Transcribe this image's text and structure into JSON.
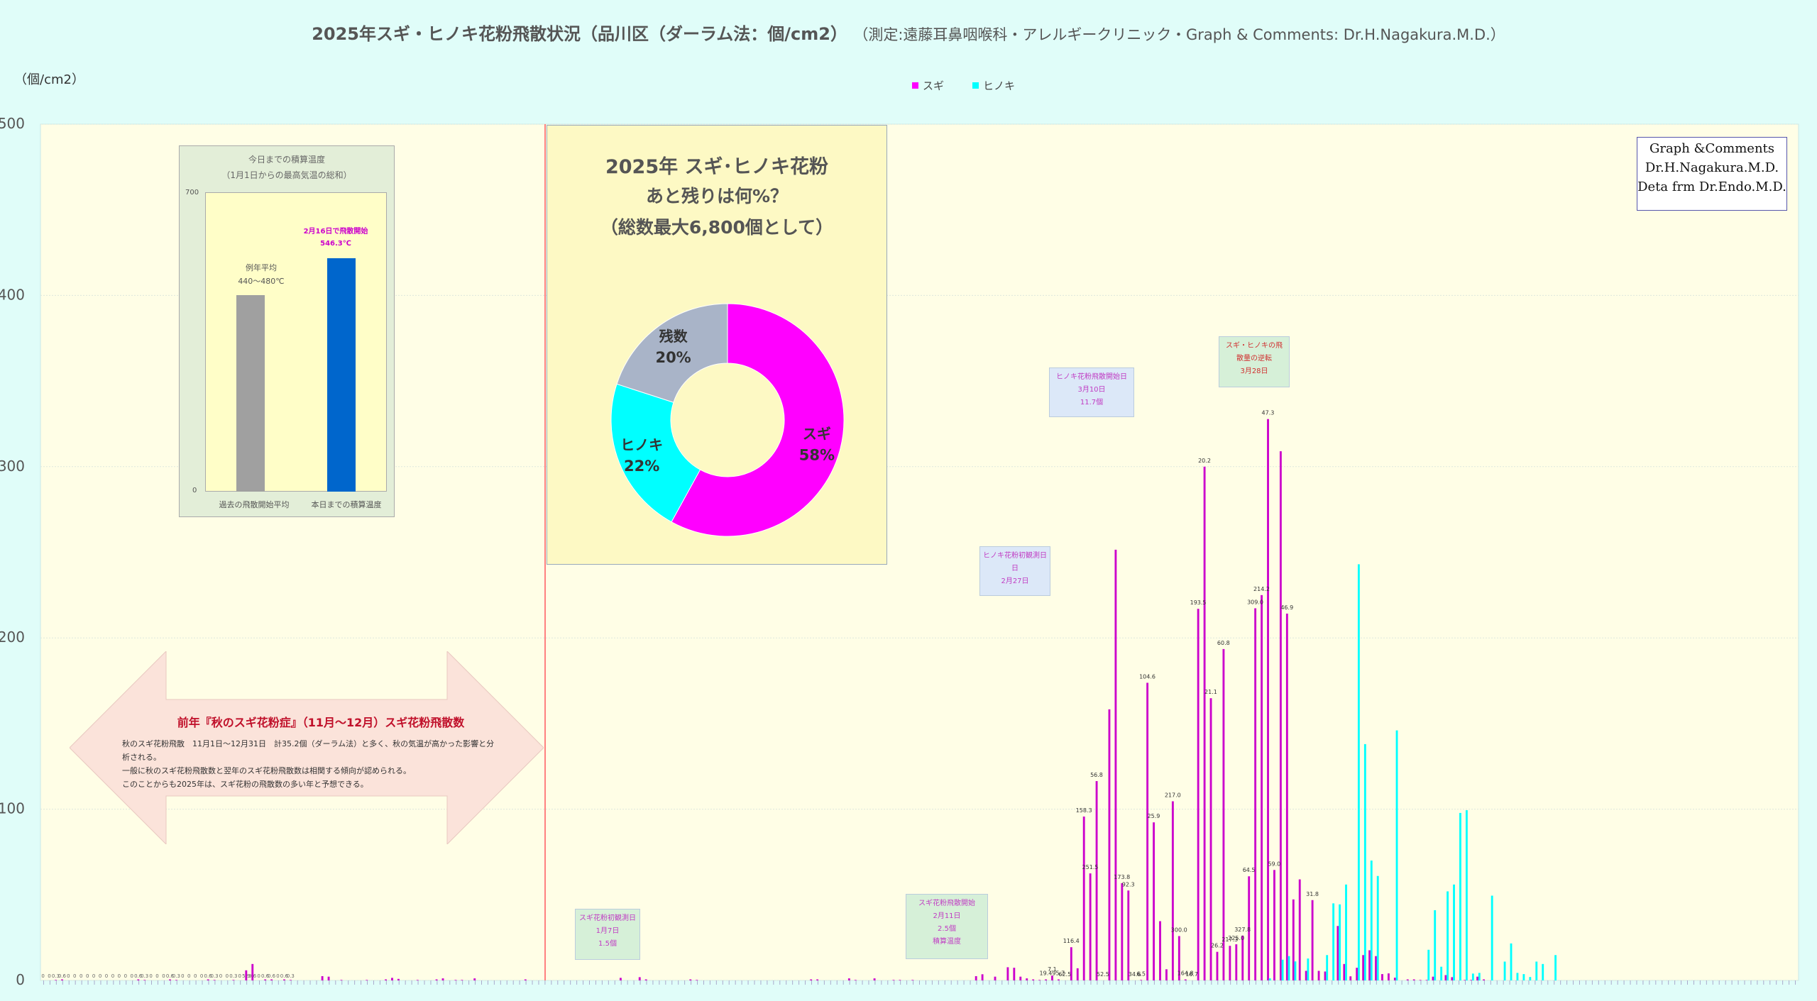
{
  "title": "2025年スギ・ヒノキ花粉飛散状況（品川区（ダーラム法：個/cm2）",
  "subtitle": "（測定:遠藤耳鼻咽喉科・アレルギークリニック・Graph & Comments: Dr.H.Nagakura.M.D.）",
  "unit": "（個/cm2）",
  "credit": [
    "Graph &Comments",
    "Dr.H.Nagakura.M.D.",
    "Deta frm Dr.Endo.M.D."
  ],
  "colors": {
    "sugi": "#ff00ff",
    "hinoki": "#00ffff",
    "plot_bg": "#fffee6",
    "page_bg": "#e0fdf9",
    "divider": "#ff8080",
    "bar_purple": "#cc00cc"
  },
  "chart_data": [
    {
      "type": "bar",
      "ylim": [
        0,
        500
      ],
      "yticks": [
        0,
        100,
        200,
        300,
        400,
        500
      ],
      "grid": true,
      "legend_position": "top",
      "series": [
        {
          "name": "スギ",
          "color": "#ff00ff",
          "values": [
            0,
            0,
            0.3,
            0.6,
            0,
            0,
            0,
            0,
            0,
            0,
            0,
            0,
            0,
            0,
            0,
            0.6,
            0.3,
            0,
            0,
            0,
            0.6,
            0.3,
            0,
            0,
            0,
            0,
            0.6,
            0.3,
            0,
            0,
            0.3,
            0,
            5.9,
            9.6,
            0,
            0.6,
            0.6,
            0,
            0.6,
            0.3,
            0,
            0,
            0,
            0,
            2.5,
            2.2,
            0,
            0.3,
            0,
            0,
            0,
            0.3,
            0,
            0,
            0.6,
            1.5,
            0.9,
            0,
            0,
            0.3,
            0,
            0,
            0.6,
            1.2,
            0,
            0.3,
            0.3,
            0,
            1.2,
            0,
            0,
            0,
            0,
            0,
            0,
            0,
            0.6,
            0,
            0,
            0,
            0,
            0,
            0,
            0,
            0,
            0,
            0,
            0,
            0,
            0,
            0,
            1.5,
            0,
            0,
            1.9,
            0.6,
            0,
            0,
            0,
            0,
            0,
            0,
            0.6,
            0.3,
            0,
            0,
            0,
            0,
            0,
            0,
            0,
            0,
            0,
            0,
            0,
            0,
            0,
            0,
            0,
            0,
            0,
            0.6,
            0.6,
            0,
            0,
            0,
            0,
            1.2,
            0.3,
            0,
            0,
            1.2,
            0,
            0,
            0.3,
            0.3,
            0,
            0.3,
            0,
            0,
            0,
            0,
            0,
            0,
            0,
            0,
            0,
            2.5,
            3.6,
            0,
            2.2,
            0,
            7.7,
            7.4,
            2.2,
            1.2,
            0.6,
            0.3,
            0.6,
            2.8,
            0.6,
            0,
            19.4,
            7.1,
            95.7,
            62.5,
            116.4,
            0,
            158.3,
            251.5,
            56.8,
            52.5,
            0,
            0.3,
            173.8,
            92.3,
            34.6,
            6.5,
            104.6,
            25.9,
            0.6,
            0,
            217.0,
            300.0,
            164.8,
            16.7,
            193.5,
            20.2,
            21.1,
            26.2,
            60.8,
            217.3,
            225.0,
            327.8,
            64.5,
            309.0,
            214.2,
            47.3,
            59.0,
            5.6,
            46.9,
            5.6,
            5.2,
            0,
            31.8,
            9.6,
            2.4,
            7.4,
            14.8,
            17.6,
            14.2,
            3.7,
            4.1,
            1.6,
            0,
            0.6,
            0.6,
            0.3,
            0.3,
            2.2,
            0,
            3.1,
            1.9,
            0,
            0.3,
            0.3,
            2.2,
            0.6,
            0,
            0,
            0,
            0,
            0,
            0,
            0,
            0,
            0,
            0,
            0,
            0,
            0,
            0,
            0,
            0,
            0,
            0,
            0,
            0,
            0,
            0,
            0,
            0,
            0,
            0,
            0,
            0,
            0,
            0,
            0,
            0,
            0,
            0,
            0,
            0,
            0,
            0,
            0,
            0,
            0,
            0,
            0,
            0,
            0,
            0,
            0,
            0,
            0
          ]
        },
        {
          "name": "ヒノキ",
          "color": "#00ffff",
          "values": [
            0,
            0,
            0,
            0,
            0,
            0,
            0,
            0,
            0,
            0,
            0,
            0,
            0,
            0,
            0,
            0,
            0,
            0,
            0,
            0,
            0,
            0,
            0,
            0,
            0,
            0,
            0,
            0,
            0,
            0,
            0,
            0,
            0,
            0,
            0,
            0,
            0,
            0,
            0,
            0,
            0,
            0,
            0,
            0,
            0,
            0,
            0,
            0,
            0,
            0,
            0,
            0,
            0,
            0,
            0,
            0,
            0,
            0,
            0,
            0,
            0,
            0,
            0,
            0,
            0,
            0,
            0,
            0,
            0,
            0,
            0,
            0,
            0,
            0,
            0,
            0,
            0,
            0,
            0,
            0,
            0,
            0,
            0,
            0,
            0,
            0,
            0,
            0,
            0,
            0,
            0,
            0,
            0,
            0,
            0,
            0,
            0,
            0,
            0,
            0,
            0,
            0,
            0,
            0,
            0,
            0,
            0,
            0,
            0,
            0,
            0,
            0,
            0,
            0,
            0,
            0,
            0,
            0,
            0,
            0,
            0,
            0,
            0,
            0,
            0,
            0,
            0,
            0,
            0,
            0,
            0,
            0,
            0,
            0,
            0,
            0,
            0,
            0,
            0,
            0,
            0,
            0,
            0,
            0,
            0,
            0,
            0,
            0,
            0,
            0,
            0,
            0,
            0,
            0,
            0,
            0,
            0,
            0,
            0,
            0,
            0,
            0,
            0,
            0,
            0,
            0,
            0,
            0,
            0,
            0,
            0,
            0,
            0,
            0,
            0,
            0,
            0,
            0,
            0,
            0,
            0,
            0,
            0,
            0,
            0,
            0,
            0,
            0,
            0,
            0,
            0,
            0,
            0,
            1.2,
            0,
            12.1,
            14.2,
            11.1,
            0,
            12.8,
            0,
            0,
            14.8,
            45.0,
            44.4,
            56.0,
            0,
            243.0,
            138.0,
            70.0,
            61.0,
            0,
            0,
            146.0,
            0,
            0,
            0,
            0,
            17.9,
            41.0,
            8.0,
            52.0,
            56.0,
            97.8,
            99.4,
            4.0,
            4.4,
            0,
            49.5,
            0,
            11.0,
            21.6,
            4.4,
            3.7,
            2.0,
            11.0,
            9.6,
            0,
            14.8,
            0,
            0,
            0,
            0,
            0,
            0,
            0,
            0,
            0,
            0,
            0,
            0,
            0,
            0,
            0,
            0,
            0,
            0,
            0,
            0,
            0,
            0,
            0,
            0,
            0,
            0,
            0,
            0,
            0,
            0,
            0,
            0,
            0,
            0,
            0,
            0,
            0,
            0,
            0,
            0,
            0,
            0,
            0,
            0,
            0,
            0,
            0,
            0
          ]
        }
      ],
      "labeled_values": [
        {
          "i": 158,
          "v": "19.4"
        },
        {
          "i": 159,
          "v": "7.1"
        },
        {
          "i": 160,
          "v": "95.7"
        },
        {
          "i": 161,
          "v": "62.5"
        },
        {
          "i": 162,
          "v": "116.4"
        },
        {
          "i": 164,
          "v": "158.3"
        },
        {
          "i": 165,
          "v": "251.5"
        },
        {
          "i": 166,
          "v": "56.8"
        },
        {
          "i": 167,
          "v": "52.5"
        },
        {
          "i": 170,
          "v": "173.8"
        },
        {
          "i": 171,
          "v": "92.3"
        },
        {
          "i": 172,
          "v": "34.6"
        },
        {
          "i": 173,
          "v": "6.5"
        },
        {
          "i": 174,
          "v": "104.6"
        },
        {
          "i": 175,
          "v": "25.9"
        },
        {
          "i": 178,
          "v": "217.0"
        },
        {
          "i": 179,
          "v": "300.0"
        },
        {
          "i": 180,
          "v": "164.8"
        },
        {
          "i": 181,
          "v": "16.7"
        },
        {
          "i": 182,
          "v": "193.5"
        },
        {
          "i": 183,
          "v": "20.2"
        },
        {
          "i": 184,
          "v": "21.1"
        },
        {
          "i": 185,
          "v": "26.2"
        },
        {
          "i": 186,
          "v": "60.8"
        },
        {
          "i": 187,
          "v": "217.3"
        },
        {
          "i": 188,
          "v": "225.0"
        },
        {
          "i": 189,
          "v": "327.8"
        },
        {
          "i": 190,
          "v": "64.5"
        },
        {
          "i": 191,
          "v": "309.0"
        },
        {
          "i": 192,
          "v": "214.2"
        },
        {
          "i": 193,
          "v": "47.3"
        },
        {
          "i": 194,
          "v": "59.0"
        },
        {
          "i": 196,
          "v": "46.9"
        },
        {
          "i": 200,
          "v": "31.8"
        }
      ],
      "top_labels": [
        "0",
        "0",
        "0.3",
        "0.6",
        "0",
        "0",
        "0",
        "0",
        "0",
        "0",
        "0",
        "0",
        "0",
        "0",
        "0",
        "0.6",
        "0.3",
        "0",
        "0",
        "0",
        "0.6",
        "0.3",
        "0",
        "0",
        "0",
        "0",
        "0.6",
        "0.3",
        "0",
        "0",
        "0.3",
        "0",
        "5.9",
        "9.6",
        "0",
        "0.6",
        "0.6",
        "0",
        "0.6",
        "0.3"
      ]
    },
    {
      "type": "bar",
      "title": "今日までの積算温度",
      "subtitle": "（1月1日からの最高気温の総和）",
      "categories": [
        "過去の飛散開始平均",
        "本日までの積算温度"
      ],
      "values": [
        460,
        546.3
      ],
      "colors": [
        "#a0a0a0",
        "#0066cc"
      ],
      "ylim": [
        0,
        700
      ],
      "yticks": [
        "0",
        "700"
      ],
      "annotations": [
        {
          "lines": [
            "例年平均",
            "440〜480℃"
          ],
          "color": "#555555"
        },
        {
          "lines": [
            "2月16日で飛散開始",
            "546.3℃"
          ],
          "color": "#cc00cc"
        }
      ]
    },
    {
      "type": "pie",
      "title_lines": [
        "2025年  スギ･ヒノキ花粉",
        "あと残りは何%？",
        "（総数最大6,800個として）"
      ],
      "categories": [
        "スギ",
        "ヒノキ",
        "残数"
      ],
      "values": [
        58,
        22,
        20
      ],
      "labels": [
        "58%",
        "22%",
        "20%"
      ],
      "colors": [
        "#ff00ff",
        "#00ffff",
        "#a9b4c8"
      ]
    }
  ],
  "arrow_box": {
    "heading": "前年『秋のスギ花粉症』（11月〜12月）スギ花粉飛散数",
    "lines": [
      "秋のスギ花粉飛散　11月1日〜12月31日　計35.2個（ダーラム法）と多く、秋の気温が高かった影響と分",
      "析される。",
      "一般に秋のスギ花粉飛散数と翌年のスギ花粉飛散数は相関する傾向が認められる。",
      "このことからも2025年は、スギ花粉の飛散数の多い年と予想できる。"
    ]
  },
  "annotations": [
    {
      "lines": [
        "スギ花粉初観測日",
        "1月7日",
        "1.5個"
      ]
    },
    {
      "lines": [
        "スギ花粉飛散開始",
        "2月11日",
        "2.5個",
        "積算温度"
      ]
    },
    {
      "lines": [
        "ヒノキ花粉初観測日",
        "",
        "2月27日"
      ]
    },
    {
      "lines": [
        "ヒノキ花粉飛散開始日",
        "3月10日",
        "11.7個"
      ]
    },
    {
      "lines": [
        "スギ・ヒノキの飛",
        "散量の逆転",
        "3月28日"
      ]
    }
  ]
}
